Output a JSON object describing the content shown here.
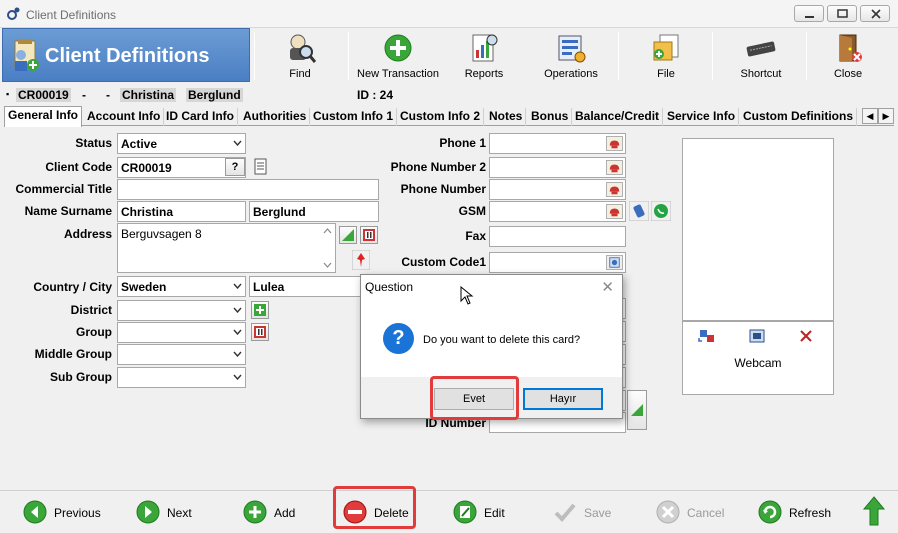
{
  "window": {
    "title": "Client Definitions"
  },
  "header": {
    "title": "Client Definitions"
  },
  "toolbar": [
    {
      "label": "Find",
      "icon": "find-icon"
    },
    {
      "label": "New Transaction",
      "icon": "new-transaction-icon"
    },
    {
      "label": "Reports",
      "icon": "reports-icon"
    },
    {
      "label": "Operations",
      "icon": "operations-icon"
    },
    {
      "label": "File",
      "icon": "file-icon"
    },
    {
      "label": "Shortcut",
      "icon": "shortcut-icon"
    },
    {
      "label": "Close",
      "icon": "close-door-icon"
    }
  ],
  "info": {
    "code": "CR00019",
    "dash1": "-",
    "dash2": "-",
    "first": "Christina",
    "last": "Berglund",
    "id_label": "ID : 24"
  },
  "tabs": [
    "General Info",
    "Account Info",
    "ID Card Info",
    "Authorities",
    "Custom Info 1",
    "Custom Info 2",
    "Notes",
    "Bonus",
    "Balance/Credit",
    "Service Info",
    "Custom Definitions"
  ],
  "form": {
    "status_label": "Status",
    "status_value": "Active",
    "client_code_label": "Client Code",
    "client_code_value": "CR00019",
    "client_code_btn": "?",
    "commercial_title_label": "Commercial Title",
    "commercial_title_value": "",
    "name_label": "Name Surname",
    "name_value": "Christina",
    "surname_value": "Berglund",
    "address_label": "Address",
    "address_value": "Berguvsagen 8",
    "country_label": "Country / City",
    "country_value": "Sweden",
    "city_value": "Lulea",
    "district_label": "District",
    "district_value": "",
    "group_label": "Group",
    "group_value": "",
    "middle_group_label": "Middle Group",
    "middle_group_value": "",
    "sub_group_label": "Sub Group",
    "sub_group_value": "",
    "phone1_label": "Phone 1",
    "phone1_value": "",
    "phone_number2_label": "Phone Number 2",
    "phone_number2_value": "",
    "phone_number_label": "Phone Number",
    "phone_number_value": "",
    "gsm_label": "GSM",
    "gsm_value": "",
    "fax_label": "Fax",
    "fax_value": "",
    "custom_code1_label": "Custom Code1",
    "custom_code1_value": "",
    "id_number_label": "ID Number"
  },
  "webcam": {
    "label": "Webcam"
  },
  "dialog": {
    "title": "Question",
    "message": "Do you want to delete this card?",
    "yes": "Evet",
    "no": "Hayır"
  },
  "bottom": [
    {
      "label": "Previous",
      "enabled": true
    },
    {
      "label": "Next",
      "enabled": true
    },
    {
      "label": "Add",
      "enabled": true
    },
    {
      "label": "Delete",
      "enabled": true
    },
    {
      "label": "Edit",
      "enabled": true
    },
    {
      "label": "Save",
      "enabled": false
    },
    {
      "label": "Cancel",
      "enabled": false
    },
    {
      "label": "Refresh",
      "enabled": true
    }
  ],
  "colors": {
    "accent": "#4a7fc4",
    "highlight": "#e23b3b",
    "green": "#3aa63a",
    "dialog_default": "#0078d7"
  }
}
